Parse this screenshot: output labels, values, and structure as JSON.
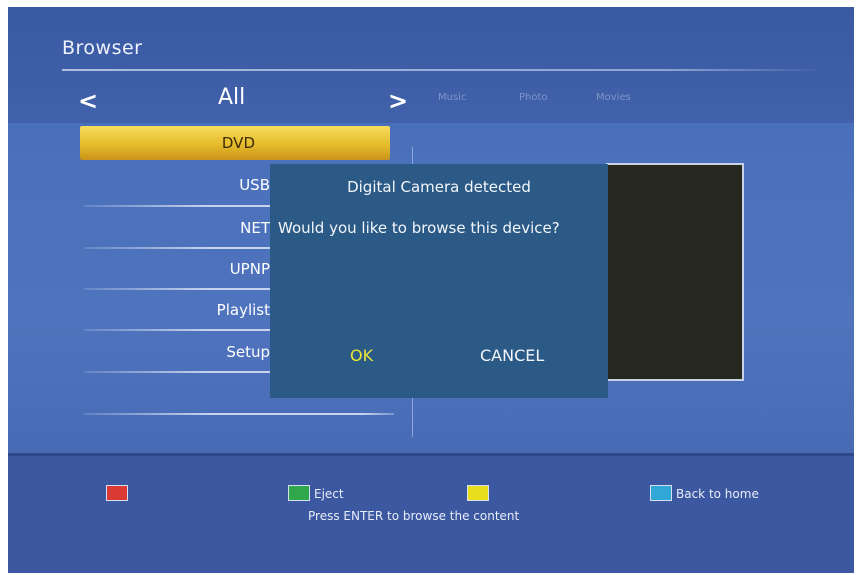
{
  "header": {
    "title": "Browser",
    "nav_prev": "<",
    "nav_current": "All",
    "nav_next": ">",
    "tabs": [
      "Music",
      "Photo",
      "Movies"
    ]
  },
  "menu": {
    "items": [
      {
        "label": "DVD",
        "selected": true
      },
      {
        "label": "USB"
      },
      {
        "label": "NET"
      },
      {
        "label": "UPNP"
      },
      {
        "label": "Playlist"
      },
      {
        "label": "Setup"
      }
    ]
  },
  "dialog": {
    "title": "Digital Camera detected",
    "message": "Would you like to browse this device?",
    "ok_label": "OK",
    "cancel_label": "CANCEL"
  },
  "footer": {
    "green_label": "Eject",
    "blue_label": "Back to home",
    "hint": "Press ENTER to browse the content"
  },
  "colors": {
    "highlight": "#e6bc2c",
    "dialog_bg": "#2c5a86",
    "ok_text": "#e9e63a",
    "key_red": "#d93a34",
    "key_green": "#2fa74a",
    "key_yellow": "#e8de1e",
    "key_blue": "#31a7d8"
  }
}
